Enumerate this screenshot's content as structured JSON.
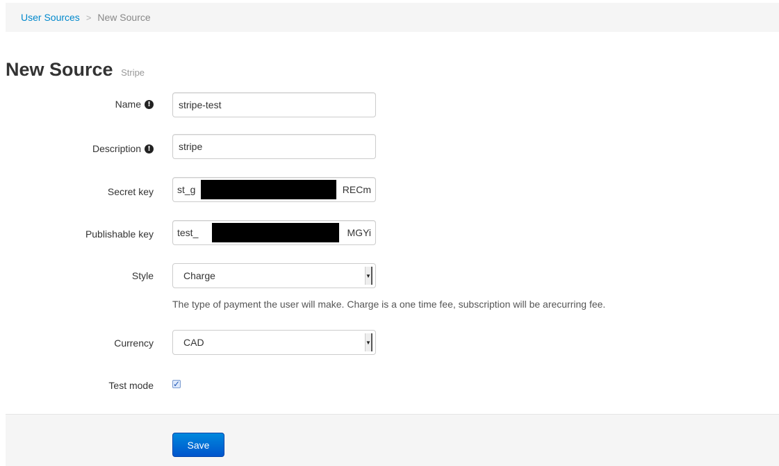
{
  "breadcrumb": {
    "parent": "User Sources",
    "separator": ">",
    "current": "New Source"
  },
  "page": {
    "title": "New Source",
    "subtitle": "Stripe"
  },
  "form": {
    "name": {
      "label": "Name",
      "value": "stripe-test"
    },
    "description": {
      "label": "Description",
      "value": "stripe"
    },
    "secret_key": {
      "label": "Secret key",
      "visible_start": "st_g",
      "visible_end": "RECm"
    },
    "publishable_key": {
      "label": "Publishable key",
      "visible_start": "test_",
      "visible_end": "MGYi"
    },
    "style": {
      "label": "Style",
      "selected": "Charge",
      "help": "The type of payment the user will make. Charge is a one time fee, subscription will be arecurring fee."
    },
    "currency": {
      "label": "Currency",
      "selected": "CAD"
    },
    "test_mode": {
      "label": "Test mode",
      "checked": true
    }
  },
  "actions": {
    "save_label": "Save"
  },
  "icons": {
    "info": "info-circle-icon",
    "checkmark": "checkmark-icon",
    "dropdown": "chevron-down-icon"
  },
  "colors": {
    "link": "#0088cc",
    "primary_button": "#0066cc"
  }
}
